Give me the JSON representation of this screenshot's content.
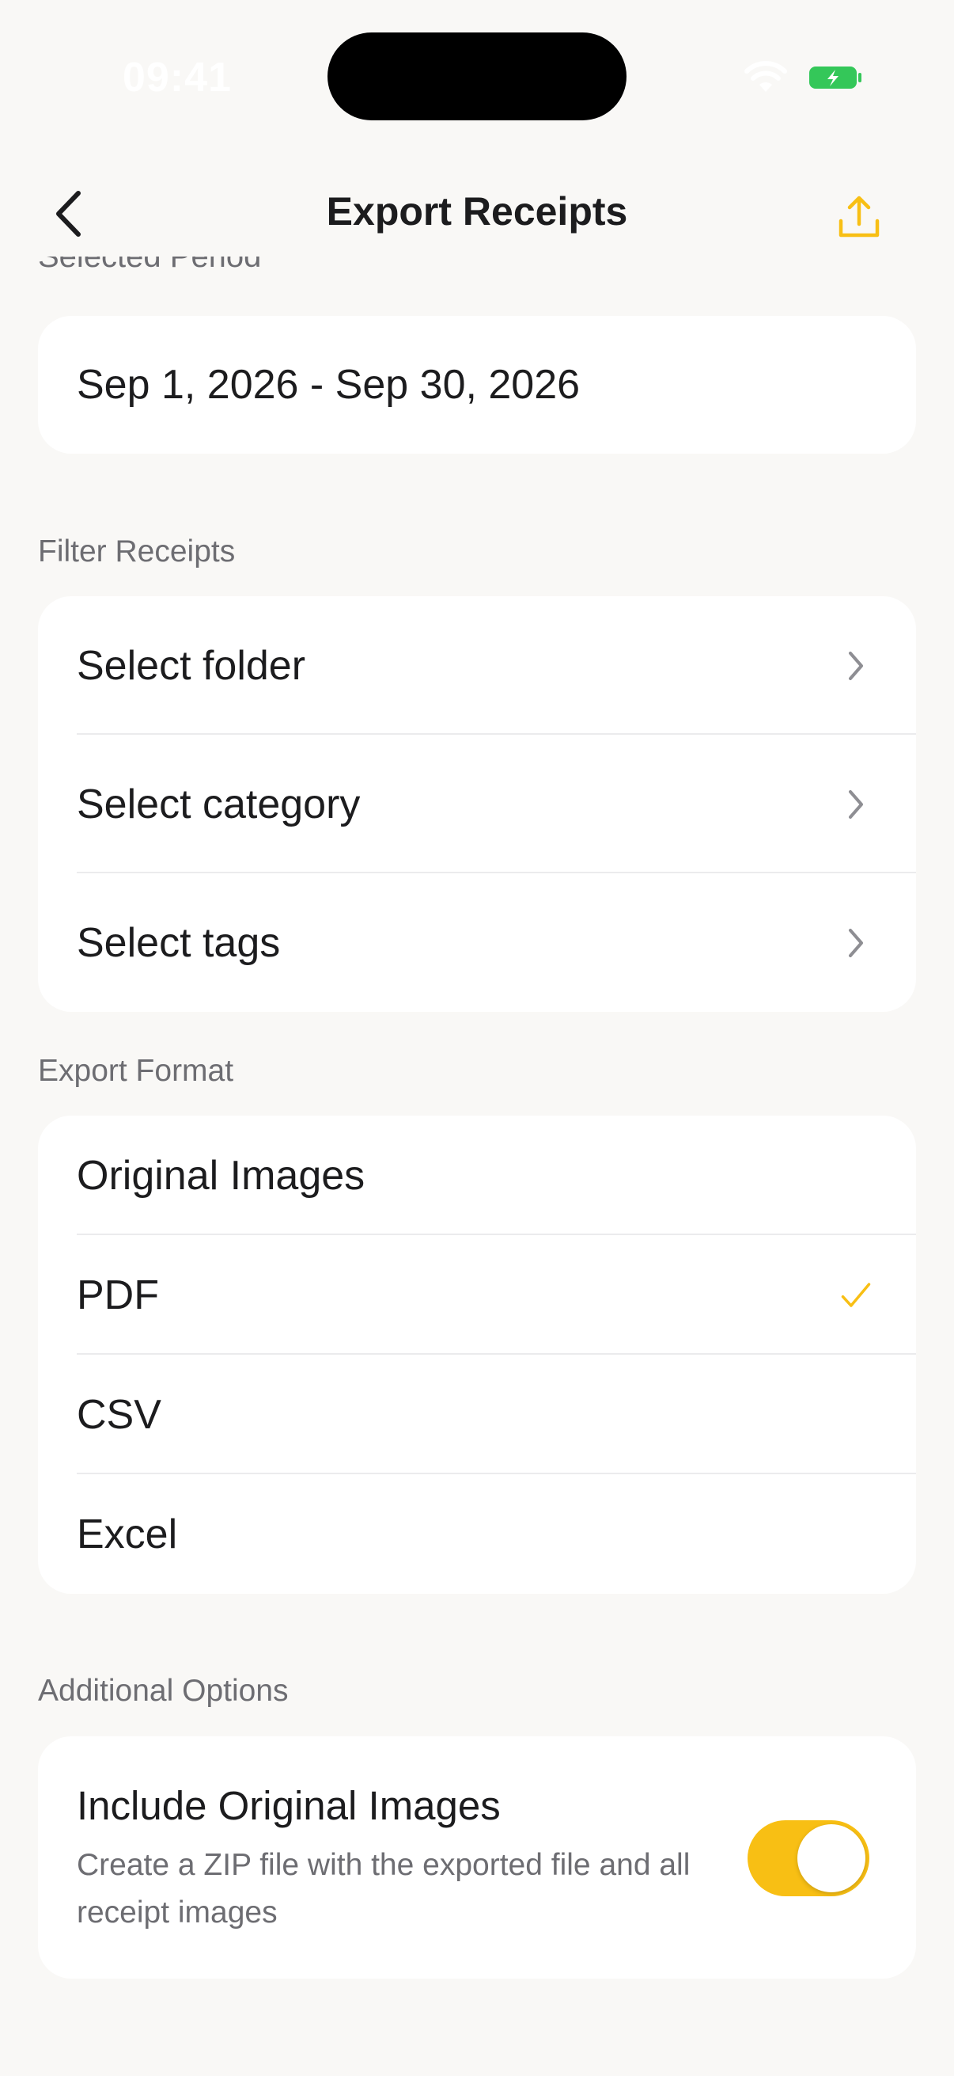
{
  "status_bar": {
    "time": "09:41"
  },
  "nav": {
    "title": "Export Receipts"
  },
  "period": {
    "section_label": "Selected Period",
    "value": "Sep 1, 2026 - Sep 30, 2026"
  },
  "filter": {
    "section_label": "Filter Receipts",
    "items": [
      {
        "label": "Select folder"
      },
      {
        "label": "Select category"
      },
      {
        "label": "Select tags"
      }
    ]
  },
  "format": {
    "section_label": "Export Format",
    "items": [
      {
        "label": "Original Images",
        "selected": false
      },
      {
        "label": "PDF",
        "selected": true
      },
      {
        "label": "CSV",
        "selected": false
      },
      {
        "label": "Excel",
        "selected": false
      }
    ]
  },
  "options": {
    "section_label": "Additional Options",
    "include_images": {
      "title": "Include Original Images",
      "description": "Create a ZIP file with the exported file and all receipt images",
      "enabled": true
    }
  },
  "colors": {
    "accent": "#f8bf14",
    "background": "#f9f8f6",
    "card": "#ffffff",
    "secondary_text": "#6d6d72",
    "battery": "#34c759"
  }
}
